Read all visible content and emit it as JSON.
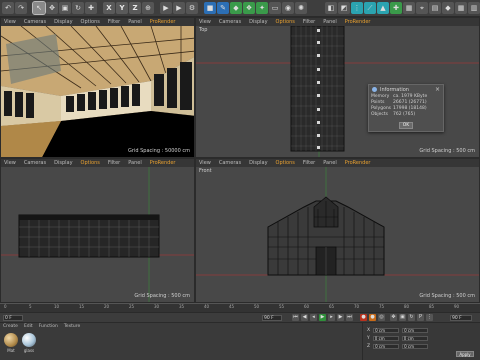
{
  "toolbar": {
    "buttons": [
      {
        "label": "",
        "icon": "undo-icon"
      },
      {
        "label": "",
        "icon": "redo-icon"
      },
      {
        "label": "",
        "icon": "live-select-icon"
      },
      {
        "label": "",
        "icon": "move-icon"
      },
      {
        "label": "X",
        "icon": "axis-x-icon"
      },
      {
        "label": "Y",
        "icon": "axis-y-icon"
      },
      {
        "label": "Z",
        "icon": "axis-z-icon"
      },
      {
        "label": "",
        "icon": "world-coord-icon"
      }
    ]
  },
  "viewports": {
    "perspective": {
      "menu": [
        "View",
        "Cameras",
        "Display",
        "Options",
        "Filter",
        "Panel",
        "ProRender"
      ],
      "active_menu": "ProRender",
      "label": "",
      "grid_spacing": "Grid Spacing : 50000 cm"
    },
    "top": {
      "menu": [
        "View",
        "Cameras",
        "Display",
        "Options",
        "Filter",
        "Panel",
        "ProRender"
      ],
      "active_menu": "Options",
      "label": "Top",
      "grid_spacing": "Grid Spacing : 500 cm"
    },
    "right": {
      "menu": [
        "View",
        "Cameras",
        "Display",
        "Options",
        "Filter",
        "Panel",
        "ProRender"
      ],
      "active_menu": "Options",
      "label": "",
      "grid_spacing": "Grid Spacing : 500 cm"
    },
    "front": {
      "menu": [
        "View",
        "Cameras",
        "Display",
        "Options",
        "Filter",
        "Panel",
        "ProRender"
      ],
      "active_menu": "Options",
      "label": "Front",
      "grid_spacing": "Grid Spacing : 500 cm"
    }
  },
  "info_dialog": {
    "title": "Information",
    "rows": [
      {
        "key": "Memory",
        "value": "ca. 1979 KByte"
      },
      {
        "key": "Points",
        "value": "26671 (26771)"
      },
      {
        "key": "Polygons",
        "value": "17998 (18148)"
      },
      {
        "key": "Objects",
        "value": "762 (765)"
      }
    ],
    "ok_label": "OK"
  },
  "timeline": {
    "ticks": [
      "0",
      "5",
      "10",
      "15",
      "20",
      "25",
      "30",
      "35",
      "40",
      "45",
      "50",
      "55",
      "60",
      "65",
      "70",
      "75",
      "80",
      "85",
      "90"
    ],
    "start_frame": "0 F",
    "current_frame": "90 F",
    "end_frame": "90 F"
  },
  "materials": {
    "menu": [
      "Create",
      "Edit",
      "Function",
      "Texture"
    ],
    "items": [
      {
        "name": "Mat",
        "color": "#b08a4a"
      },
      {
        "name": "glass",
        "color": "#a8c4d8"
      }
    ]
  },
  "coordinates": {
    "rows": [
      {
        "axis": "X",
        "pos": "0 cm",
        "size": "0 cm"
      },
      {
        "axis": "Y",
        "pos": "0 cm",
        "size": "0 cm"
      },
      {
        "axis": "Z",
        "pos": "0 cm",
        "size": "0 cm"
      }
    ],
    "apply_label": "Apply"
  },
  "colors": {
    "accent": "#e8a030",
    "viewport_bg": "#484848",
    "wire": "#111111"
  }
}
